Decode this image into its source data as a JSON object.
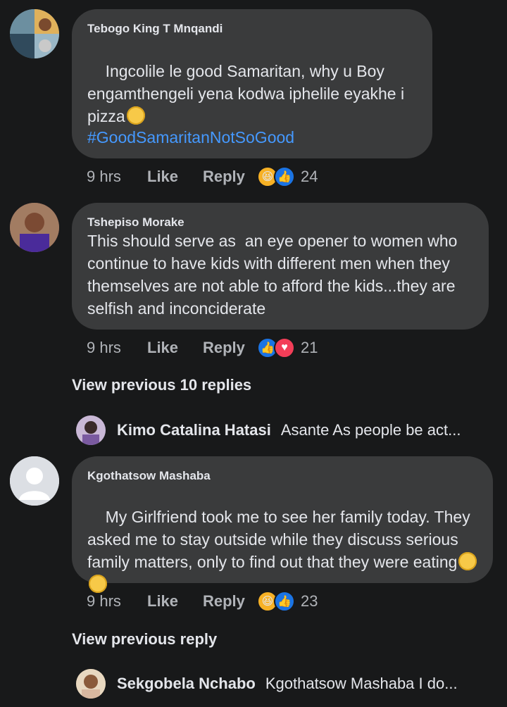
{
  "comments": [
    {
      "author": "Tebogo King T Mnqandi",
      "text": "Ingcolile le good Samaritan, why u Boy engamthengeli yena kodwa iphelile eyakhe i pizza",
      "hashtag": "#GoodSamaritanNotSoGood",
      "time": "9 hrs",
      "like": "Like",
      "reply": "Reply",
      "reactions": [
        "laugh",
        "like"
      ],
      "count": "24"
    },
    {
      "author": "Tshepiso Morake",
      "text": "This should serve as  an eye opener to women who continue to have kids with different men when they themselves are not able to afford the kids...they are selfish and inconciderate",
      "time": "9 hrs",
      "like": "Like",
      "reply": "Reply",
      "reactions": [
        "like",
        "love"
      ],
      "count": "21",
      "view_replies": "View previous 10 replies",
      "latest_reply": {
        "author": "Kimo Catalina Hatasi",
        "text": "Asante As people be act..."
      }
    },
    {
      "author": "Kgothatsow Mashaba",
      "text": "My Girlfriend took me to see her family today. They asked me to stay outside while they discuss serious family matters, only to find out that they were eating",
      "time": "9 hrs",
      "like": "Like",
      "reply": "Reply",
      "reactions": [
        "laugh",
        "like"
      ],
      "count": "23",
      "view_replies": "View previous reply",
      "latest_reply": {
        "author": "Sekgobela Nchabo",
        "text": "Kgothatsow Mashaba I do..."
      }
    }
  ],
  "icons": {
    "like": "thumbs-up-icon",
    "love": "heart-icon",
    "laugh": "laughing-face-icon"
  },
  "colors": {
    "background": "#18191a",
    "bubble": "#3a3b3c",
    "hashtag": "#4599ff",
    "like_blue": "#1b74e4",
    "love_red": "#f33e58",
    "laugh_yellow": "#f7b125"
  }
}
